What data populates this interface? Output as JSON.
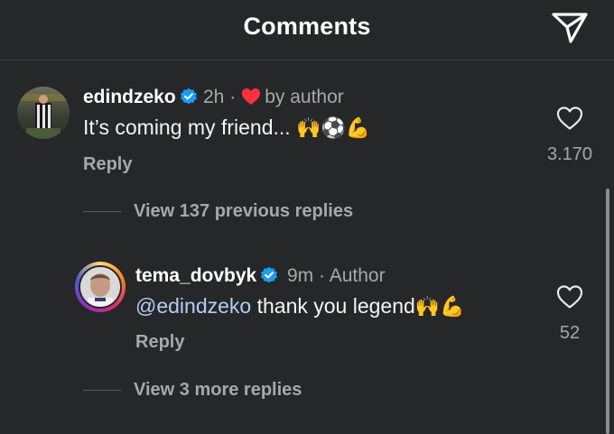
{
  "header": {
    "title": "Comments"
  },
  "comments": [
    {
      "username": "edindzeko",
      "time": "2h",
      "separator": "·",
      "liked_label": "by author",
      "text": "It’s coming my friend...",
      "emojis": "🙌⚽💪",
      "reply_label": "Reply",
      "like_count": "3.170"
    }
  ],
  "view_previous": "View 137 previous replies",
  "reply": {
    "username": "tema_dovbyk",
    "time": "9m",
    "separator": "·",
    "author_label": "Author",
    "mention": "@edindzeko",
    "text": " thank you legend",
    "emojis": "🙌💪",
    "reply_label": "Reply",
    "like_count": "52"
  },
  "view_more": "View 3 more replies",
  "colors": {
    "background": "#262729",
    "verified": "#1d9bf0",
    "heart": "#ff3040",
    "mention": "#b3cdf5"
  },
  "icons": [
    "send-icon",
    "verified-badge-icon",
    "heart-icon",
    "like-outline-icon"
  ]
}
